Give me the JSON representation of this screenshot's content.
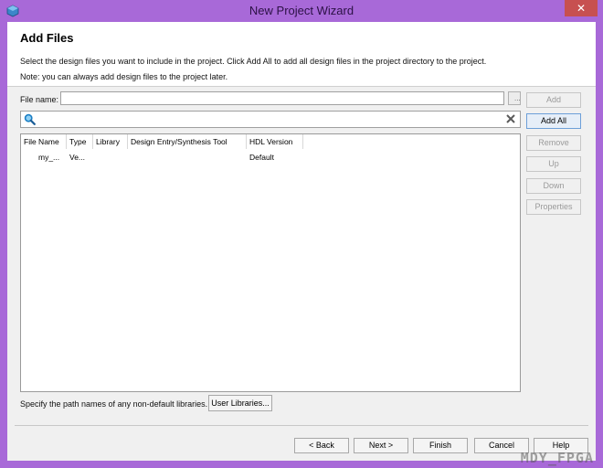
{
  "window": {
    "title": "New Project Wizard",
    "close_label": "✕"
  },
  "header": {
    "title": "Add Files",
    "description": "Select the design files you want to include in the project. Click Add All to add all design files in the project directory to the project.",
    "note": "Note: you can always add design files to the project later."
  },
  "file_name": {
    "label": "File name:",
    "value": "",
    "browse_label": "..."
  },
  "search": {
    "value": "",
    "placeholder": ""
  },
  "table": {
    "columns": [
      "File Name",
      "Type",
      "Library",
      "Design Entry/Synthesis Tool",
      "HDL Version"
    ],
    "rows": [
      {
        "file_name": "my_...",
        "type": "Ve...",
        "library": "",
        "tool": "",
        "hdl_version": "Default"
      }
    ]
  },
  "side_buttons": {
    "add": "Add",
    "add_all": "Add All",
    "remove": "Remove",
    "up": "Up",
    "down": "Down",
    "properties": "Properties"
  },
  "libraries": {
    "label": "Specify the path names of any non-default libraries.",
    "button": "User Libraries..."
  },
  "footer": {
    "back": "< Back",
    "next": "Next >",
    "finish": "Finish",
    "cancel": "Cancel",
    "help": "Help"
  },
  "watermark": "MDY_FPGA",
  "colors": {
    "window_frame": "#a869d8",
    "accent_button": "#6d9fd8"
  }
}
